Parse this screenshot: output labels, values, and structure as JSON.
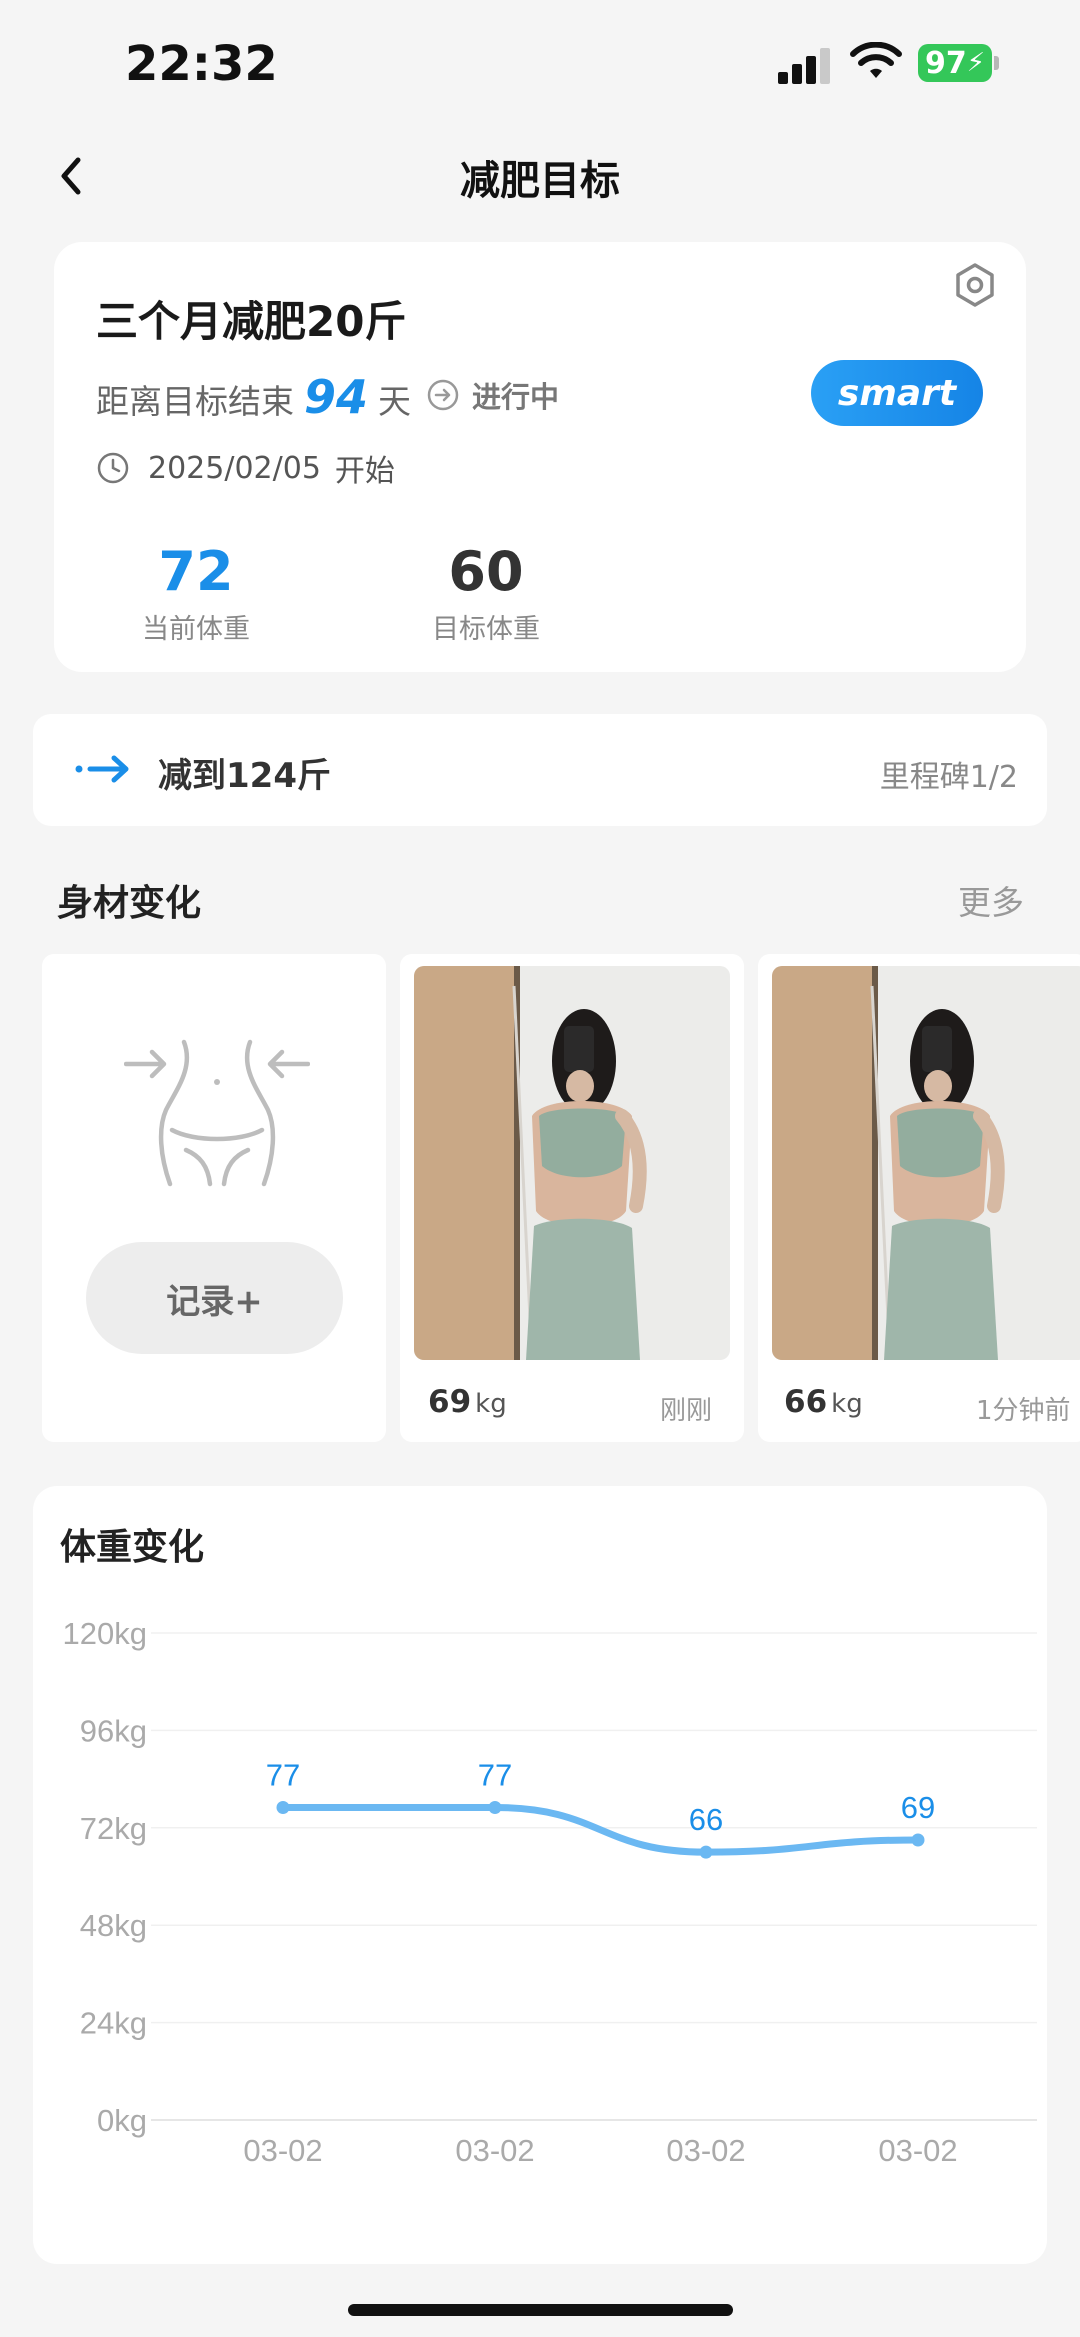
{
  "status_bar": {
    "time": "22:32",
    "battery": "97",
    "icons": [
      "signal-icon",
      "wifi-icon",
      "battery-icon"
    ]
  },
  "header": {
    "title": "减肥目标",
    "back_icon": "chevron-left-icon"
  },
  "goal": {
    "title": "三个月减肥20斤",
    "countdown_prefix": "距离目标结束",
    "days_left": "94",
    "countdown_suffix": "天",
    "status": "进行中",
    "badge": "smart",
    "start_date": "2025/02/05",
    "start_label": "开始",
    "current_weight": "72",
    "current_weight_label": "当前体重",
    "target_weight": "60",
    "target_weight_label": "目标体重"
  },
  "milestone": {
    "text": "减到124斤",
    "progress": "里程碑1/2"
  },
  "body_changes": {
    "title": "身材变化",
    "more": "更多",
    "record_button": "记录+",
    "entries": [
      {
        "weight": "69",
        "unit": "kg",
        "time": "刚刚"
      },
      {
        "weight": "66",
        "unit": "kg",
        "time": "1分钟前"
      }
    ]
  },
  "colors": {
    "accent": "#1a8ee8",
    "line": "#6bb8f2",
    "battery": "#34c759"
  },
  "weight_chart": {
    "title": "体重变化",
    "chart_data": {
      "type": "line",
      "title": "体重变化",
      "y_ticks": [
        "120kg",
        "96kg",
        "72kg",
        "48kg",
        "24kg",
        "0kg"
      ],
      "ylim": [
        0,
        120
      ],
      "categories": [
        "03-02",
        "03-02",
        "03-02",
        "03-02"
      ],
      "series": [
        {
          "values": [
            77,
            77,
            66,
            69
          ]
        }
      ],
      "grid": true,
      "smooth": true
    }
  }
}
